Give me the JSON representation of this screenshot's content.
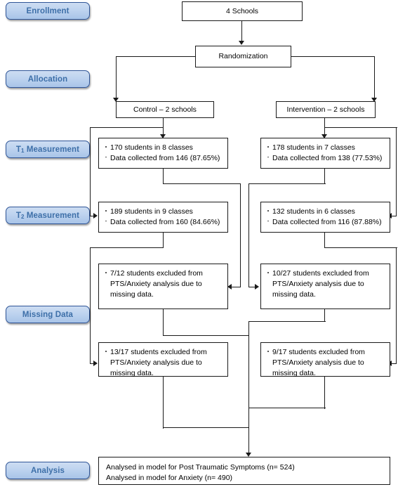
{
  "diagram": {
    "title": "CONSORT participant flow diagram",
    "stage_labels": [
      {
        "id": "enrollment",
        "label": "Enrollment"
      },
      {
        "id": "allocation",
        "label": "Allocation"
      },
      {
        "id": "t1-measurement",
        "label_prefix": "T",
        "label_sub": "1",
        "label_suffix": " Measurement"
      },
      {
        "id": "t2-measurement",
        "label_prefix": "T",
        "label_sub": "2",
        "label_suffix": " Measurement"
      },
      {
        "id": "missing-data",
        "label": "Missing Data"
      },
      {
        "id": "analysis",
        "label": "Analysis"
      }
    ],
    "nodes": {
      "schools": "4 Schools",
      "randomization": "Randomization",
      "control_arm": "Control – 2 schools",
      "intervention_arm": "Intervention – 2 schools",
      "t1_control": {
        "line1": "170 students in 8 classes",
        "line2": "Data collected from 146 (87.65%)"
      },
      "t1_intervention": {
        "line1": "178 students in 7 classes",
        "line2": "Data collected from 138 (77.53%)"
      },
      "t2_control": {
        "line1": "189 students in 9 classes",
        "line2": "Data collected from 160 (84.66%)"
      },
      "t2_intervention": {
        "line1": "132 students in 6 classes",
        "line2": "Data collected from 116 (87.88%)"
      },
      "missing_t1_control": "7/12 students excluded from\nPTS/Anxiety analysis due to\nmissing data.",
      "missing_t1_intervention": "10/27 students excluded from\nPTS/Anxiety analysis due to\nmissing data.",
      "missing_t2_control": "13/17 students excluded from\nPTS/Anxiety analysis due to\nmissing data.",
      "missing_t2_intervention": "9/17 students excluded from\nPTS/Anxiety analysis due to\nmissing data.",
      "analysis": {
        "line1": "Analysed  in model for Post Traumatic Symptoms (n= 524)",
        "line2": "Analysed  in model for Anxiety (n= 490)"
      }
    },
    "colors": {
      "pill_fill_top": "#cdddf2",
      "pill_fill_bottom": "#a8c4e8",
      "pill_border": "#2f5597",
      "pill_text": "#3d6fa8",
      "box_border": "#1a1a1a",
      "box_fill": "#ffffff",
      "connector": "#1a1a1a",
      "page_background": "#ffffff"
    }
  }
}
